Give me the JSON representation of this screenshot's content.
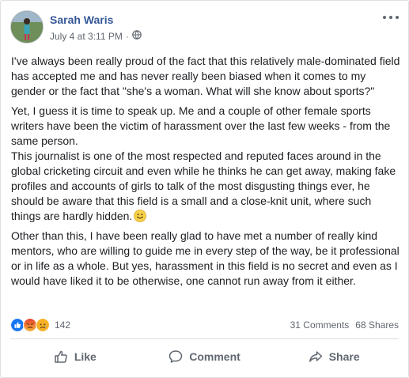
{
  "post": {
    "author": "Sarah Waris",
    "timestamp": "July 4 at 3:11 PM",
    "separator": "·",
    "privacy_icon": "globe-icon",
    "paragraphs": [
      "I've always been really proud of the fact that this relatively male-dominated field has accepted me and has never really been biased when it comes to my gender or the fact that \"she's a woman. What will she know about sports?\"",
      "Yet, I guess it is time to speak up. Me and a couple of other female sports writers have been the victim of harassment over the last few weeks - from the same person.",
      "This journalist is one of the most respected and reputed faces around in the global cricketing circuit and even while he thinks he can get away, making fake profiles and accounts of girls to talk of the most disgusting things ever, he should be aware that this field is a small and a close-knit unit, where such things are hardly hidden.",
      "Other than this, I have been really glad to have met a number of really kind mentors, who are willing to guide me in every step of the way, be it professional or in life as a whole. But yes, harassment in this field is no secret and even as I would have liked it to be otherwise, one cannot run away from it either."
    ]
  },
  "reactions": {
    "icons": [
      "like-icon",
      "angry-icon",
      "sad-icon"
    ],
    "count": "142",
    "comments": "31 Comments",
    "shares": "68 Shares"
  },
  "actions": {
    "like": "Like",
    "comment": "Comment",
    "share": "Share"
  },
  "colors": {
    "author_link": "#365899",
    "like_blue": "#1877f2",
    "angry": "#e9710f",
    "sad": "#f7b125"
  }
}
